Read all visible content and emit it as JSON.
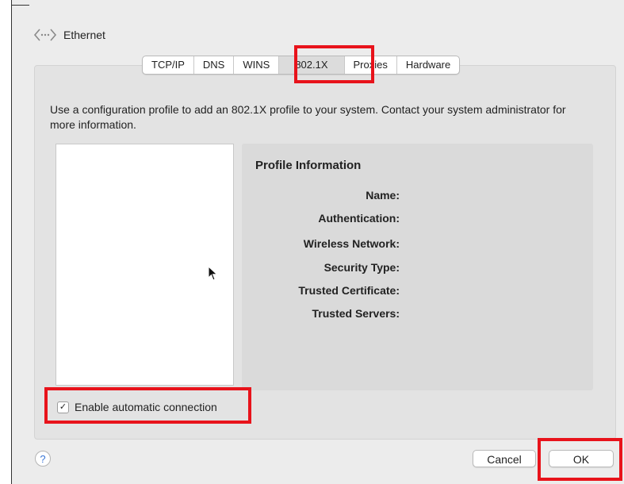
{
  "header": {
    "title": "Ethernet",
    "icon": "network-arrows-icon"
  },
  "tabs": [
    {
      "label": "TCP/IP",
      "selected": false
    },
    {
      "label": "DNS",
      "selected": false
    },
    {
      "label": "WINS",
      "selected": false
    },
    {
      "label": "802.1X",
      "selected": true
    },
    {
      "label": "Proxies",
      "selected": false
    },
    {
      "label": "Hardware",
      "selected": false
    }
  ],
  "description": "Use a configuration profile to add an 802.1X profile to your system. Contact your system administrator for more information.",
  "profile_info": {
    "title": "Profile Information",
    "fields": [
      {
        "label": "Name:"
      },
      {
        "label": "Authentication:"
      },
      {
        "label": "Wireless Network:"
      },
      {
        "label": "Security Type:"
      },
      {
        "label": "Trusted Certificate:"
      },
      {
        "label": "Trusted Servers:"
      }
    ]
  },
  "auto_connect": {
    "label": "Enable automatic connection",
    "checked": true
  },
  "buttons": {
    "help": "?",
    "cancel": "Cancel",
    "ok": "OK"
  },
  "highlight_color": "#e8131b"
}
